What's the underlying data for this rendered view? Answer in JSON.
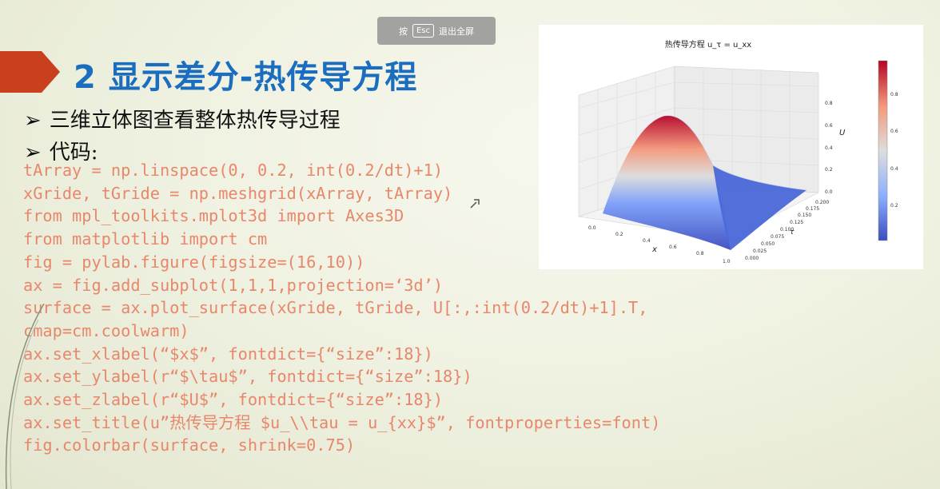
{
  "esc_banner": {
    "prefix": "按",
    "key": "Esc",
    "suffix": "退出全屏"
  },
  "slide": {
    "title": "2 显示差分-热传导方程",
    "bullets": [
      "三维立体图查看整体热传导过程",
      "代码:"
    ],
    "bullet_icon": "arrow-bullet-icon",
    "code_lines": [
      "tArray = np.linspace(0, 0.2, int(0.2/dt)+1)",
      "xGride, tGride = np.meshgrid(xArray, tArray)",
      "from mpl_toolkits.mplot3d import Axes3D",
      "from matplotlib import cm",
      "fig = pylab.figure(figsize=(16,10))",
      "ax = fig.add_subplot(1,1,1,projection=‘3d’)",
      "surface = ax.plot_surface(xGride, tGride, U[:,:int(0.2/dt)+1].T,",
      "cmap=cm.coolwarm)",
      "ax.set_xlabel(“$x$”, fontdict={“size”:18})",
      "ax.set_ylabel(r“$\\tau$”, fontdict={“size”:18})",
      "ax.set_zlabel(r“$U$”, fontdict={“size”:18})",
      "ax.set_title(u”热传导方程 $u_\\\\tau = u_{xx}$”, fontproperties=font)",
      "fig.colorbar(surface, shrink=0.75)"
    ],
    "colors": {
      "title": "#1a6dbf",
      "code": "#e8876b",
      "ribbon": "#c8401e"
    }
  },
  "figure": {
    "title": "热传导方程 u_τ = u_xx",
    "xlabel": "x",
    "ylabel": "τ",
    "zlabel": "U",
    "x_ticks": [
      "0.0",
      "0.2",
      "0.4",
      "0.6",
      "0.8",
      "1.0"
    ],
    "t_ticks": [
      "0.000",
      "0.025",
      "0.050",
      "0.075",
      "0.100",
      "0.125",
      "0.150",
      "0.175",
      "0.200"
    ],
    "z_ticks": [
      "0.0",
      "0.2",
      "0.4",
      "0.6",
      "0.8"
    ],
    "colorbar_ticks": [
      "0.2",
      "0.4",
      "0.6",
      "0.8"
    ],
    "colormap": "coolwarm",
    "surface_peak": 0.95
  }
}
